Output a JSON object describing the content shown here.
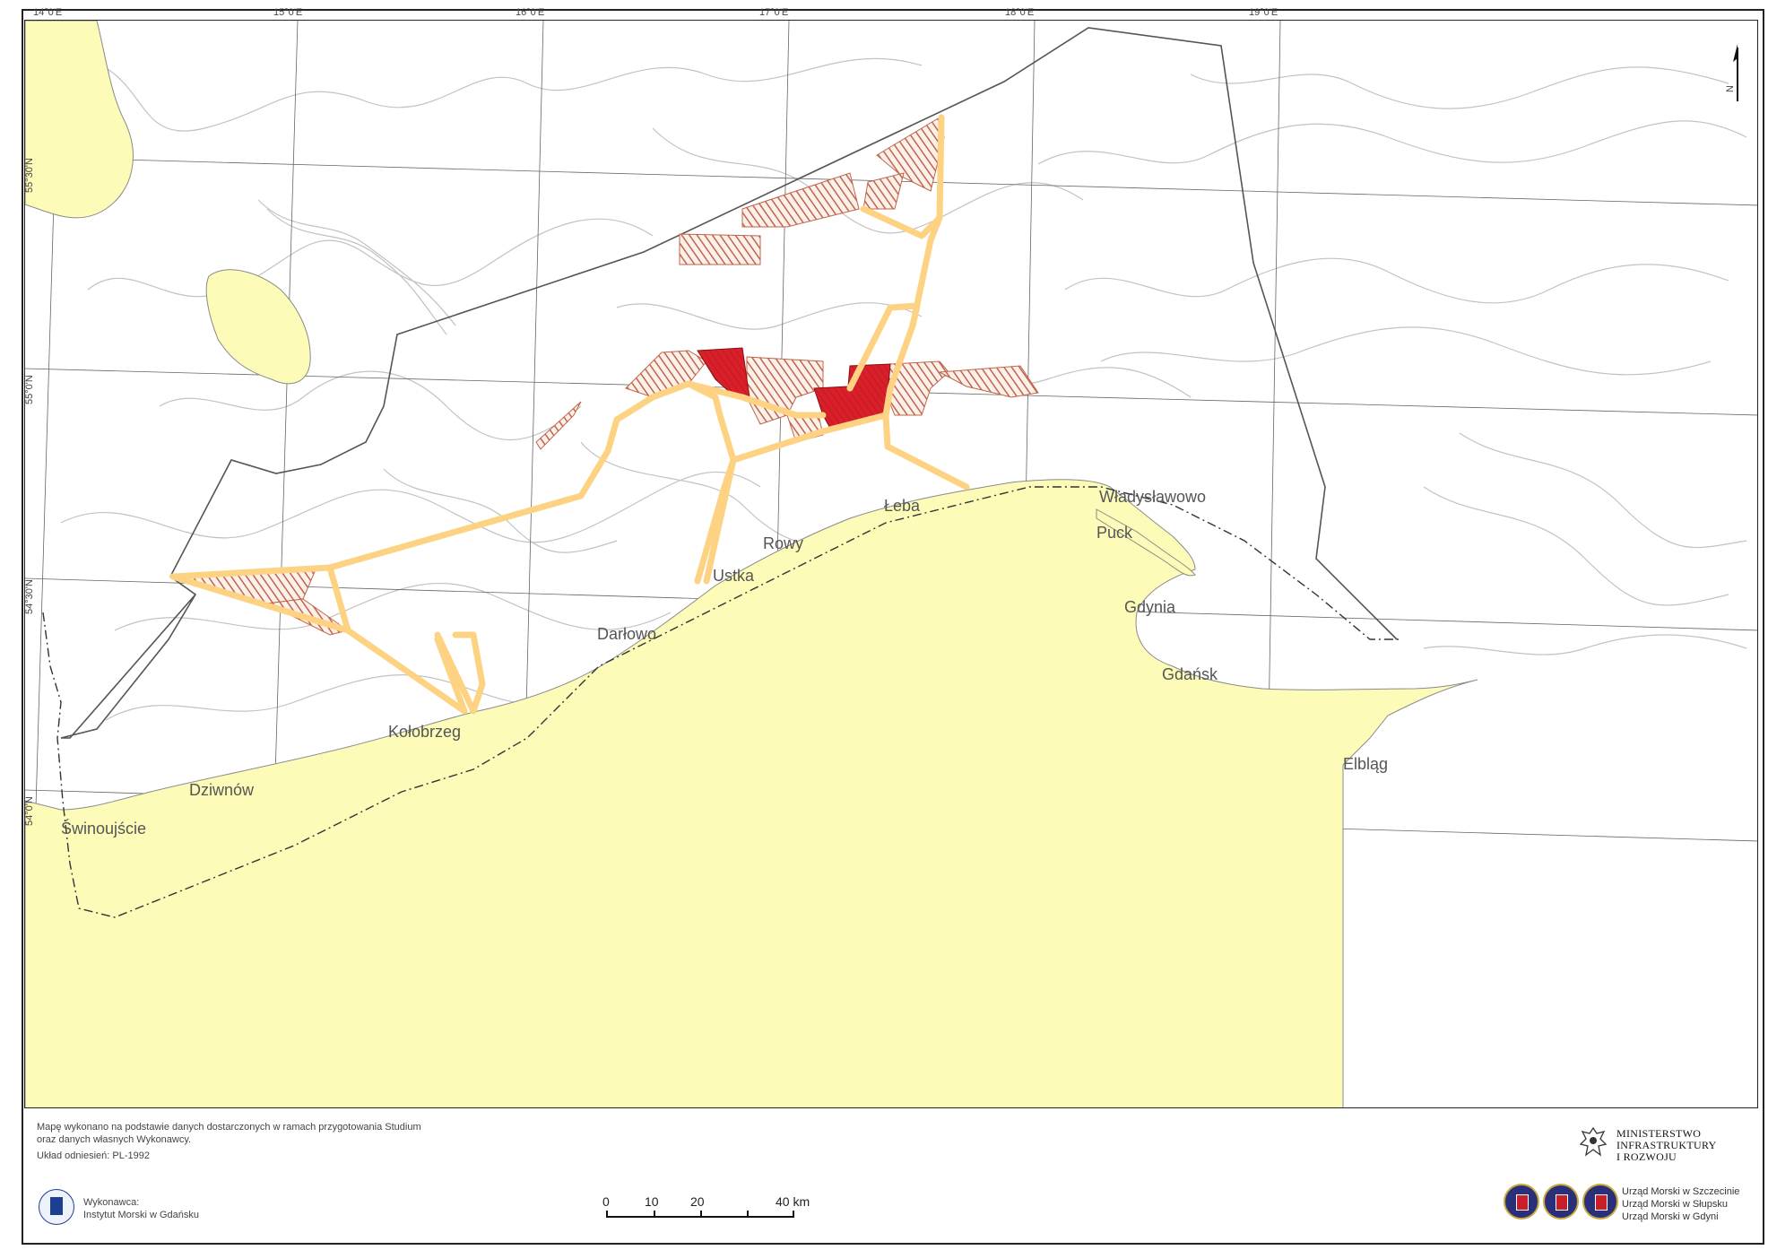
{
  "map": {
    "lon_ticks": [
      "14°0'E",
      "15°0'E",
      "16°0'E",
      "17°0'E",
      "18°0'E",
      "19°0'E"
    ],
    "lat_ticks": [
      "55°30'N",
      "55°0'N",
      "54°30'N",
      "54°0'N"
    ],
    "north_label": "N",
    "places": {
      "wladyslawowo": "Władysławowo",
      "puck": "Puck",
      "gdynia": "Gdynia",
      "gdansk": "Gdańsk",
      "elblag": "Elbląg",
      "leba": "Łeba",
      "rowy": "Rowy",
      "ustka": "Ustka",
      "darlowo": "Darłowo",
      "kolobrzeg": "Kołobrzeg",
      "dziwnow": "Dziwnów",
      "swinoujscie": "Świnoujście"
    },
    "colors": {
      "land": "#fdfbb8",
      "route": "#fdd383",
      "area_hatch": "#c0654a",
      "area_solid": "#d9202a",
      "contour": "#bdbdbd"
    }
  },
  "footer": {
    "note_line1": "Mapę wykonano na podstawie danych dostarczonych w ramach przygotowania Studium",
    "note_line2": "oraz danych własnych Wykonawcy.",
    "note_line3": "Układ odniesień: PL-1992",
    "contractor_label": "Wykonawca:",
    "contractor_name": "Instytut Morski w Gdańsku",
    "scale": {
      "ticks": [
        "0",
        "10",
        "20",
        "40 km"
      ]
    },
    "ministry": {
      "line1": "MINISTERSTWO",
      "line2": "INFRASTRUKTURY",
      "line3": "I ROZWOJU"
    },
    "offices": [
      "Urząd Morski w Szczecinie",
      "Urząd Morski w Słupsku",
      "Urząd Morski w Gdyni"
    ]
  }
}
